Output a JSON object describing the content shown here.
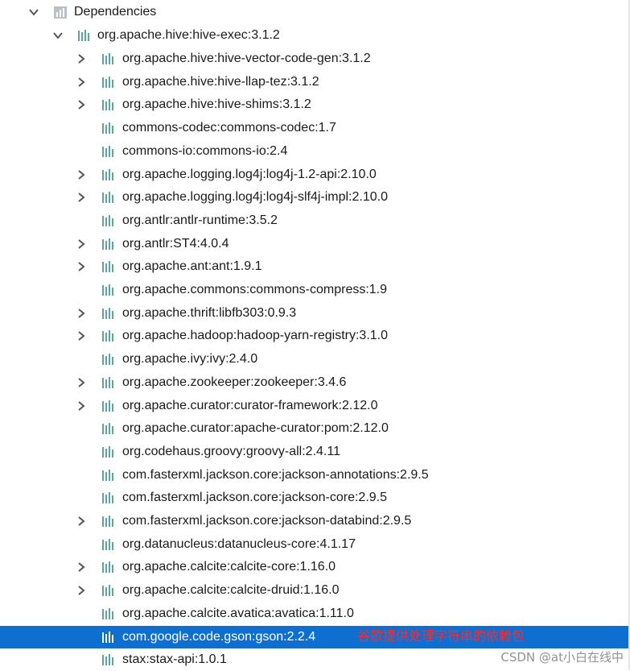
{
  "colors": {
    "selection": "#0f6fd0",
    "annotation": "#ff2a2a",
    "library_icon": "#5aa7a0"
  },
  "root": {
    "label": "Dependencies",
    "expanded": true,
    "icon": "bar-chart-folder-icon"
  },
  "group": {
    "label": "org.apache.hive:hive-exec:3.1.2",
    "expanded": true,
    "icon": "library-icon"
  },
  "items": [
    {
      "label": "org.apache.hive:hive-vector-code-gen:3.1.2",
      "expandable": true
    },
    {
      "label": "org.apache.hive:hive-llap-tez:3.1.2",
      "expandable": true
    },
    {
      "label": "org.apache.hive:hive-shims:3.1.2",
      "expandable": true
    },
    {
      "label": "commons-codec:commons-codec:1.7",
      "expandable": false
    },
    {
      "label": "commons-io:commons-io:2.4",
      "expandable": false
    },
    {
      "label": "org.apache.logging.log4j:log4j-1.2-api:2.10.0",
      "expandable": true
    },
    {
      "label": "org.apache.logging.log4j:log4j-slf4j-impl:2.10.0",
      "expandable": true
    },
    {
      "label": "org.antlr:antlr-runtime:3.5.2",
      "expandable": false
    },
    {
      "label": "org.antlr:ST4:4.0.4",
      "expandable": true
    },
    {
      "label": "org.apache.ant:ant:1.9.1",
      "expandable": true
    },
    {
      "label": "org.apache.commons:commons-compress:1.9",
      "expandable": false
    },
    {
      "label": "org.apache.thrift:libfb303:0.9.3",
      "expandable": true
    },
    {
      "label": "org.apache.hadoop:hadoop-yarn-registry:3.1.0",
      "expandable": true
    },
    {
      "label": "org.apache.ivy:ivy:2.4.0",
      "expandable": false
    },
    {
      "label": "org.apache.zookeeper:zookeeper:3.4.6",
      "expandable": true
    },
    {
      "label": "org.apache.curator:curator-framework:2.12.0",
      "expandable": true
    },
    {
      "label": "org.apache.curator:apache-curator:pom:2.12.0",
      "expandable": false
    },
    {
      "label": "org.codehaus.groovy:groovy-all:2.4.11",
      "expandable": false
    },
    {
      "label": "com.fasterxml.jackson.core:jackson-annotations:2.9.5",
      "expandable": false
    },
    {
      "label": "com.fasterxml.jackson.core:jackson-core:2.9.5",
      "expandable": false
    },
    {
      "label": "com.fasterxml.jackson.core:jackson-databind:2.9.5",
      "expandable": true
    },
    {
      "label": "org.datanucleus:datanucleus-core:4.1.17",
      "expandable": false
    },
    {
      "label": "org.apache.calcite:calcite-core:1.16.0",
      "expandable": true
    },
    {
      "label": "org.apache.calcite:calcite-druid:1.16.0",
      "expandable": true
    },
    {
      "label": "org.apache.calcite.avatica:avatica:1.11.0",
      "expandable": false
    },
    {
      "label": "com.google.code.gson:gson:2.2.4",
      "expandable": false,
      "selected": true,
      "annotation": "谷歌提供处理字符串的依赖包"
    },
    {
      "label": "stax:stax-api:1.0.1",
      "expandable": false
    }
  ],
  "watermark": "CSDN @at小白在线中"
}
